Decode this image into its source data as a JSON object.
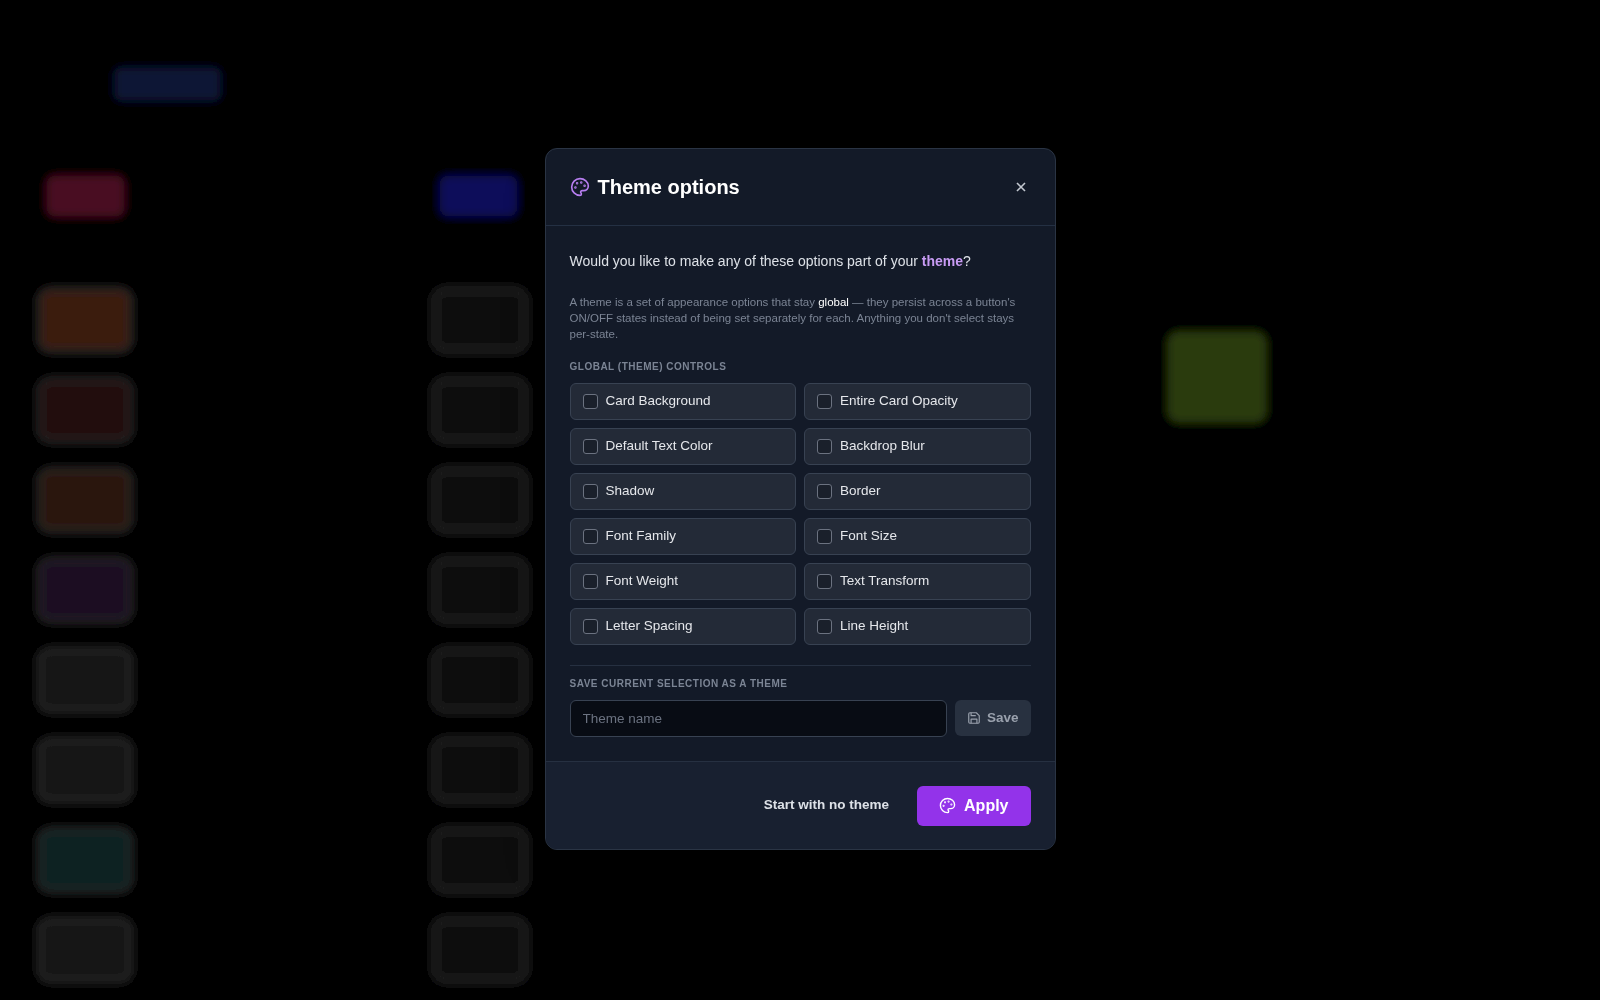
{
  "dialog": {
    "title": "Theme options",
    "question": "Would you like to make any of these options part of your **theme**?",
    "description": "A theme is a set of appearance options that stay **global** — they persist across a button's ON/OFF states instead of being set separately for each. Anything you don't select stays per-state.",
    "controls_heading": "GLOBAL (THEME) CONTROLS",
    "options": [
      {
        "label": "Card Background",
        "checked": false
      },
      {
        "label": "Entire Card Opacity",
        "checked": false
      },
      {
        "label": "Default Text Color",
        "checked": false
      },
      {
        "label": "Backdrop Blur",
        "checked": false
      },
      {
        "label": "Shadow",
        "checked": false
      },
      {
        "label": "Border",
        "checked": false
      },
      {
        "label": "Font Family",
        "checked": false
      },
      {
        "label": "Font Size",
        "checked": false
      },
      {
        "label": "Font Weight",
        "checked": false
      },
      {
        "label": "Text Transform",
        "checked": false
      },
      {
        "label": "Letter Spacing",
        "checked": false
      },
      {
        "label": "Line Height",
        "checked": false
      }
    ],
    "save_heading": "SAVE CURRENT SELECTION AS A THEME",
    "name_field": {
      "placeholder": "Theme name"
    },
    "save_button": "Save",
    "secondary_button": "Start with no theme",
    "apply_button": "Apply"
  }
}
